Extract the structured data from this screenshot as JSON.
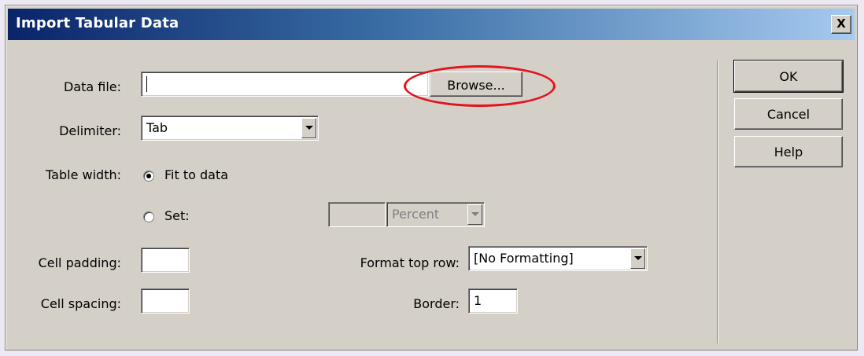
{
  "window": {
    "title": "Import Tabular Data",
    "close_label": "X"
  },
  "form": {
    "data_file": {
      "label": "Data file:",
      "value": "",
      "browse_label": "Browse..."
    },
    "delimiter": {
      "label": "Delimiter:",
      "value": "Tab"
    },
    "table_width": {
      "label": "Table width:",
      "options": [
        {
          "label": "Fit to data",
          "checked": true
        },
        {
          "label": "Set:",
          "checked": false
        }
      ],
      "set_value": "",
      "unit_value": "Percent"
    },
    "cell_padding": {
      "label": "Cell padding:",
      "value": ""
    },
    "cell_spacing": {
      "label": "Cell spacing:",
      "value": ""
    },
    "format_top_row": {
      "label": "Format top row:",
      "value": "[No Formatting]"
    },
    "border": {
      "label": "Border:",
      "value": "1"
    }
  },
  "buttons": {
    "ok": "OK",
    "cancel": "Cancel",
    "help": "Help"
  },
  "colors": {
    "title_gradient_start": "#0a246a",
    "title_gradient_end": "#a6caf0",
    "dialog_face": "#d4d0c8",
    "highlight_ellipse": "#e5131c"
  }
}
